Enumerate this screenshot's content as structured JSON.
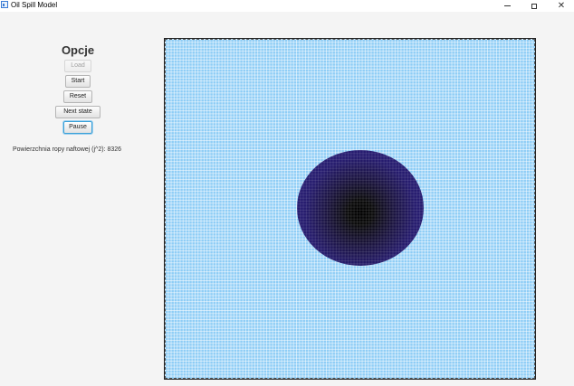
{
  "window": {
    "title": "Oil Spill Model",
    "minimize_icon": "minimize-icon",
    "maximize_icon": "maximize-icon",
    "close_glyph": "✕"
  },
  "panel": {
    "title": "Opcje",
    "buttons": {
      "load": "Load",
      "start": "Start",
      "reset": "Reset",
      "next_state": "Next state",
      "pause": "Pause"
    },
    "load_enabled": false,
    "focused_button": "pause",
    "area_text": "Powierzchnia ropy naftowej (j^2): 8326"
  },
  "simulation": {
    "water_color": "#8ecdf6",
    "oil_edge_color": "#2a1f7a",
    "oil_core_color": "#000000",
    "grid_line_color": "#ffffff"
  }
}
